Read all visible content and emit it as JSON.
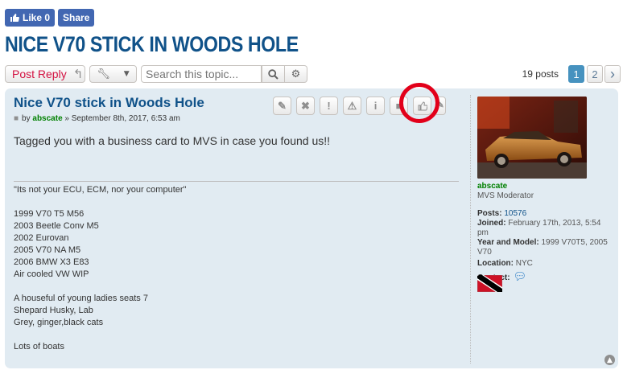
{
  "social": {
    "like_label": "Like 0",
    "share_label": "Share",
    "brand_color": "#4267b2"
  },
  "topic": {
    "title": "NICE V70 STICK IN WOODS HOLE"
  },
  "toolbar": {
    "post_reply_label": "Post Reply",
    "search_placeholder": "Search this topic...",
    "posts_count": "19 posts",
    "pages": [
      "1",
      "2"
    ],
    "current_page": "1",
    "next_label": "›"
  },
  "post": {
    "title": "Nice V70 stick in Woods Hole",
    "by_label": "by",
    "author": "abscate",
    "date": "» September 8th, 2017, 6:53 am",
    "body": "Tagged you with a business card to MVS in case you found us!!",
    "buttons": [
      "edit-icon",
      "delete-icon",
      "report-icon",
      "warn-icon",
      "info-icon",
      "lock-icon",
      "like-icon",
      "quote-icon"
    ],
    "signature": [
      "\"Its not your ECU, ECM, nor your computer\"",
      "",
      "1999 V70 T5 M56",
      "2003 Beetle Conv M5",
      "2002 Eurovan",
      "2005 V70 NA M5",
      "2006 BMW X3 E83",
      "Air cooled VW WIP",
      "",
      "A houseful of young ladies seats 7",
      "Shepard Husky, Lab",
      "Grey, ginger,black cats",
      "",
      "Lots of boats"
    ]
  },
  "profile": {
    "username": "abscate",
    "rank": "MVS Moderator",
    "posts_label": "Posts:",
    "posts_value": "10576",
    "joined_label": "Joined:",
    "joined_value": "February 17th, 2013, 5:54 pm",
    "year_model_label": "Year and Model:",
    "year_model_value": "1999 V70T5, 2005 V70",
    "location_label": "Location:",
    "location_value": "NYC",
    "contact_label": "Contact:"
  },
  "colors": {
    "accent": "#105289",
    "reply_red": "#d31141",
    "post_bg": "#e1ebf2",
    "highlight_red": "#e2001a",
    "username_green": "#008000"
  }
}
